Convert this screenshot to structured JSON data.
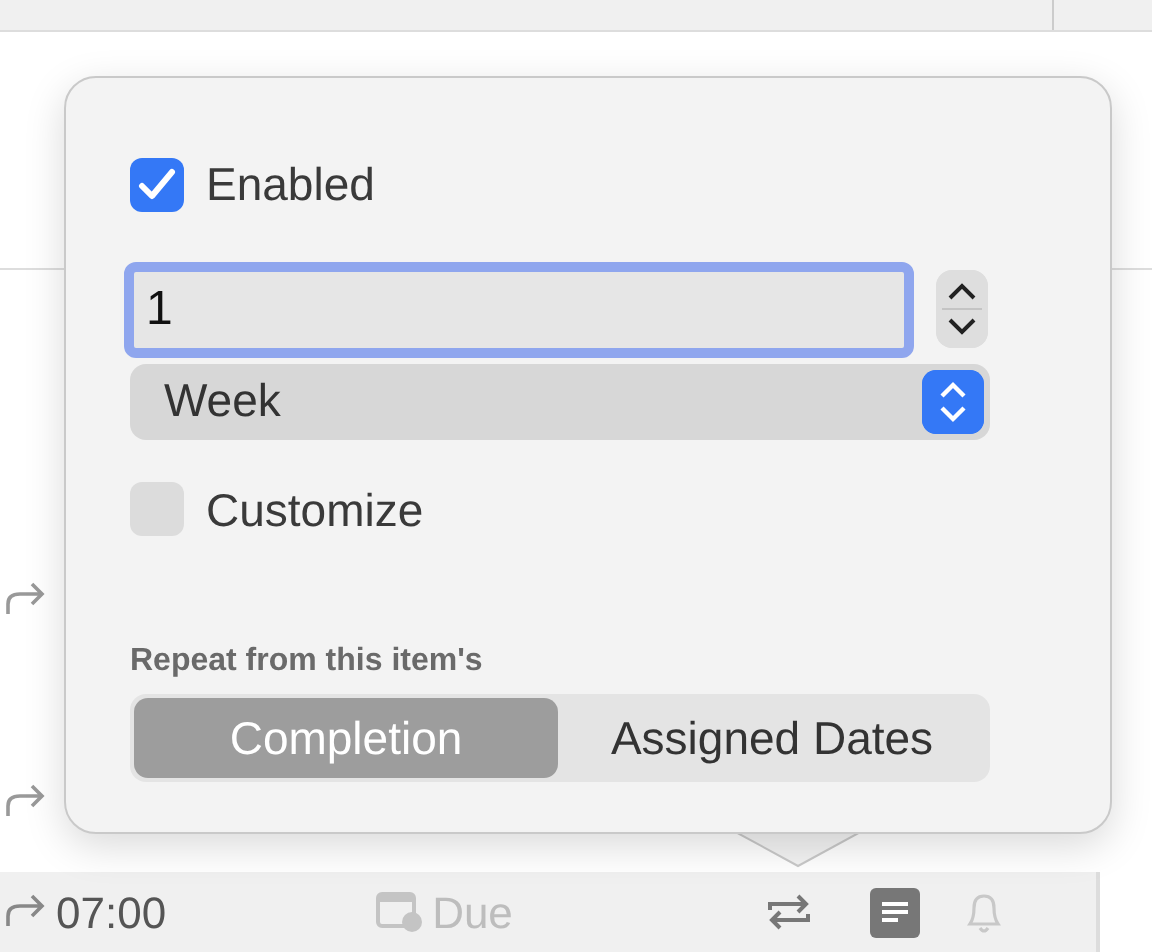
{
  "popover": {
    "enabled": {
      "label": "Enabled",
      "checked": true
    },
    "interval": {
      "value": "1"
    },
    "unit": {
      "value": "Week"
    },
    "customize": {
      "label": "Customize",
      "checked": false
    },
    "repeat_from": {
      "label": "Repeat from this item's",
      "options": [
        {
          "label": "Completion",
          "selected": true
        },
        {
          "label": "Assigned Dates",
          "selected": false
        }
      ]
    }
  },
  "task_row": {
    "time": "07:00",
    "due": "Due"
  }
}
